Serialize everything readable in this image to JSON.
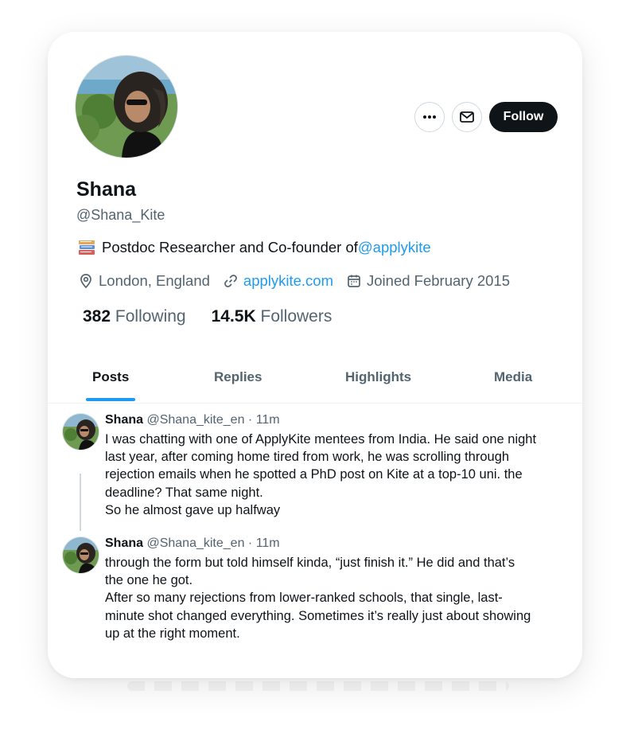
{
  "profile": {
    "name": "Shana",
    "handle": "@Shana_Kite",
    "bio_emoji_icon": "books-icon",
    "bio_text": "Postdoc Researcher and Co-founder of ",
    "bio_mention": "@applykite",
    "location": "London, England",
    "website": "applykite.com",
    "joined": "Joined February 2015",
    "following_count": "382",
    "following_label": "Following",
    "followers_count": "14.5K",
    "followers_label": "Followers"
  },
  "actions": {
    "more_icon": "more-icon",
    "message_icon": "mail-icon",
    "follow_label": "Follow"
  },
  "tabs": [
    {
      "label": "Posts",
      "active": true
    },
    {
      "label": "Replies",
      "active": false
    },
    {
      "label": "Highlights",
      "active": false
    },
    {
      "label": "Media",
      "active": false
    }
  ],
  "posts": [
    {
      "name": "Shana",
      "meta": "@Shana_kite_en · 11m",
      "lines": [
        "I was chatting with one of  ApplyKite mentees from India. He said one night",
        "last year, after coming home tired from work, he was scrolling through",
        "rejection emails when he spotted a PhD post on Kite at a top-10 uni. the",
        "deadline? That same night.",
        "So he almost gave up halfway"
      ]
    },
    {
      "name": "Shana",
      "meta": "@Shana_kite_en · 11m",
      "lines": [
        "through the form but told himself kinda, “just finish it.” He did and that’s",
        "the one he got.",
        "After so many rejections from lower-ranked schools, that single, last-",
        "minute shot changed everything. Sometimes it’s really just about showing",
        "up at the right moment."
      ]
    }
  ],
  "colors": {
    "accent": "#1d9bf0",
    "text": "#0f1419",
    "muted": "#536471"
  }
}
